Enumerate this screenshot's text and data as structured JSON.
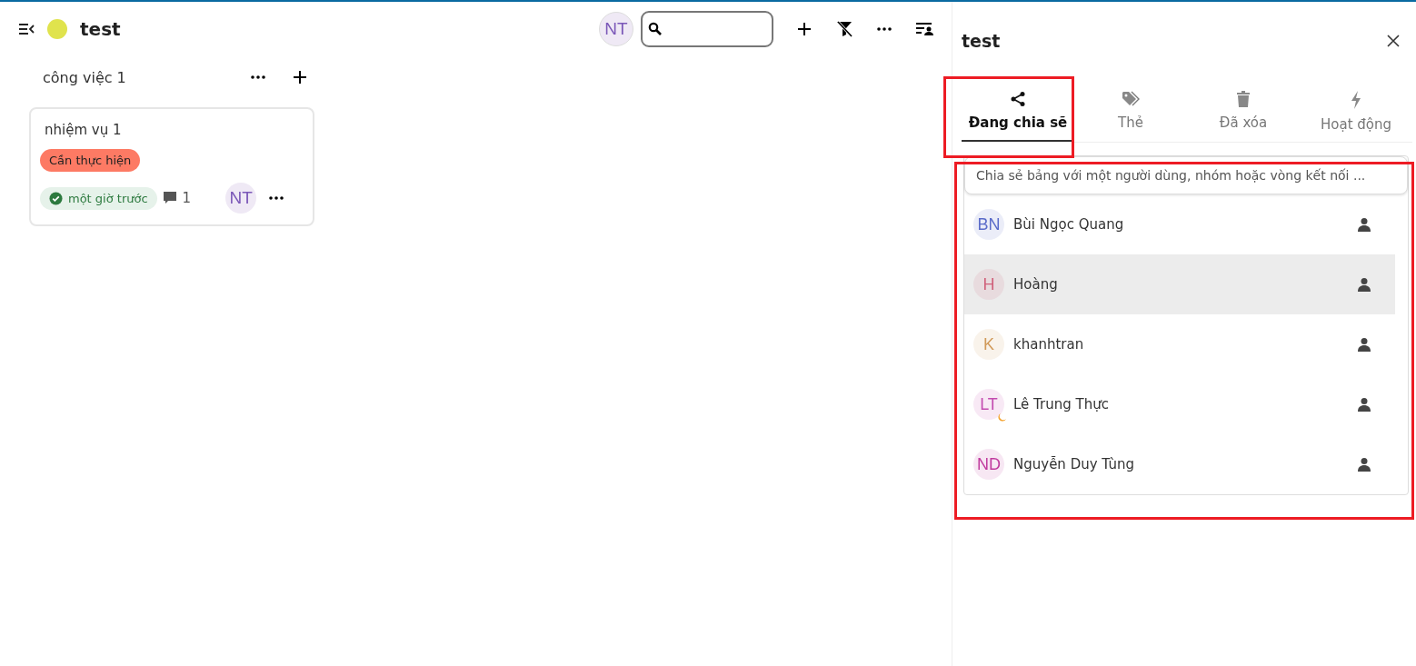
{
  "board": {
    "title": "test",
    "color": "#e0e34d"
  },
  "toolbar": {
    "user_initials": "NT"
  },
  "stacks": [
    {
      "title": "công việc 1",
      "cards": [
        {
          "title": "nhiệm vụ 1",
          "labels": [
            {
              "text": "Cần thực hiện",
              "color": "#fd7a64"
            }
          ],
          "due": {
            "text": "một giờ trước",
            "done": true
          },
          "comments": "1",
          "assignee": "NT"
        }
      ]
    }
  ],
  "sidebar": {
    "title": "test",
    "tabs": [
      {
        "label": "Đang chia sẽ",
        "selected": true
      },
      {
        "label": "Thẻ",
        "selected": false
      },
      {
        "label": "Đã xóa",
        "selected": false
      },
      {
        "label": "Hoạt động",
        "selected": false
      }
    ],
    "share_field": {
      "placeholder": "Chia sẻ bảng với một người dùng, nhóm hoặc vòng kết nối ..."
    },
    "users": [
      {
        "initials": "BN",
        "name": "Bùi Ngọc Quang",
        "color": "#5a6bc9",
        "selected": false,
        "away": false
      },
      {
        "initials": "H",
        "name": "Hoàng",
        "color": "#d0607a",
        "selected": true,
        "away": false
      },
      {
        "initials": "K",
        "name": "khanhtran",
        "color": "#d19a5a",
        "selected": false,
        "away": false
      },
      {
        "initials": "LT",
        "name": "Lê Trung Thực",
        "color": "#c34bb0",
        "selected": false,
        "away": true
      },
      {
        "initials": "ND",
        "name": "Nguyễn Duy Tùng",
        "color": "#c03a9e",
        "selected": false,
        "away": false
      }
    ]
  }
}
